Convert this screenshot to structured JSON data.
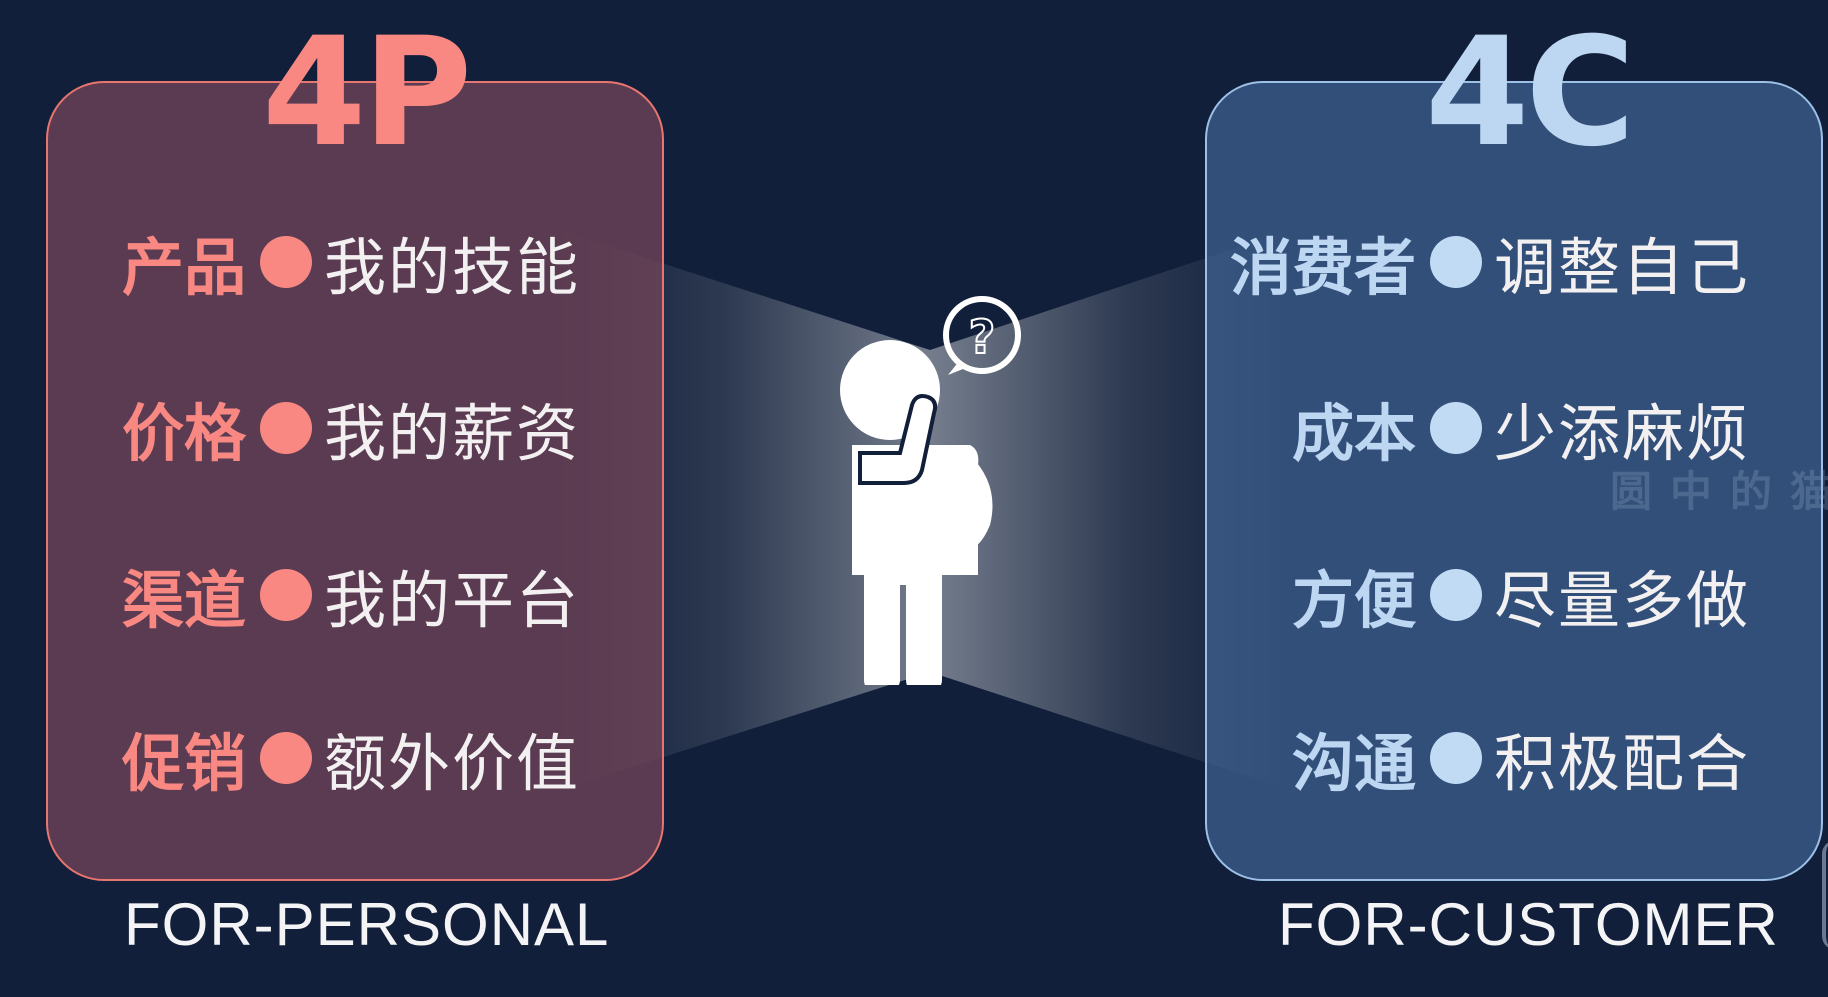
{
  "left": {
    "title": "4P",
    "subtitle": "FOR-PERSONAL",
    "accent_color": "#f98882",
    "rows": [
      {
        "key": "产品",
        "value": "我的技能"
      },
      {
        "key": "价格",
        "value": "我的薪资"
      },
      {
        "key": "渠道",
        "value": "我的平台"
      },
      {
        "key": "促销",
        "value": "额外价值"
      }
    ]
  },
  "right": {
    "title": "4C",
    "subtitle": "FOR-CUSTOMER",
    "accent_color": "#bdd6f2",
    "rows": [
      {
        "key": "消费者",
        "value": "调整自己"
      },
      {
        "key": "成本",
        "value": "少添麻烦"
      },
      {
        "key": "方便",
        "value": "尽量多做"
      },
      {
        "key": "沟通",
        "value": "积极配合"
      }
    ]
  },
  "center": {
    "figure_icon": "thinking-person-icon",
    "question_mark": "?"
  },
  "watermark": "圆中的猫"
}
